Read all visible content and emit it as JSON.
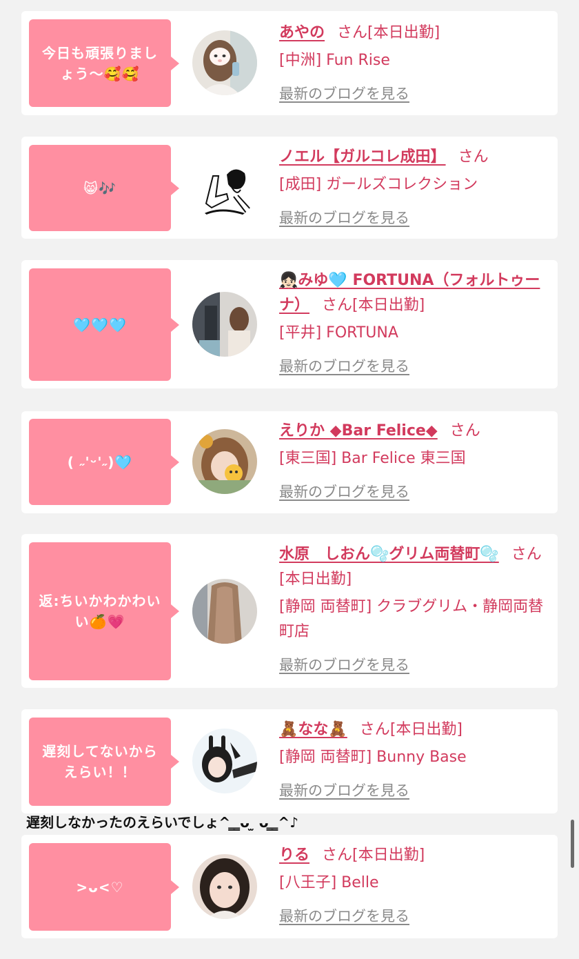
{
  "colors": {
    "bubble": "#ff8fa1",
    "name": "#d23a5d",
    "link": "#8a8a8a",
    "background": "#f2f2f2"
  },
  "posts": [
    {
      "bubble_text": "今日も頑張りましょう〜🥰🥰",
      "name": "あやの",
      "san": "さん",
      "status": "[本日出勤]",
      "shop": "[中洲] Fun Rise",
      "blog_link": "最新のブログを見る",
      "avatar_icon": "avatar-photo"
    },
    {
      "bubble_text": "😸🎶",
      "name": "ノエル【ガルコレ成田】",
      "san": "さん",
      "status": "",
      "shop": "[成田] ガールズコレクション",
      "blog_link": "最新のブログを見る",
      "avatar_icon": "avatar-illustration"
    },
    {
      "bubble_text": "🩵🩵🩵",
      "name": "👧🏻みゆ🩵 FORTUNA（フォルトゥーナ）",
      "san": "さん",
      "status": "[本日出勤]",
      "shop": "[平井] FORTUNA",
      "blog_link": "最新のブログを見る",
      "avatar_icon": "avatar-photo"
    },
    {
      "bubble_text": "( ˶'ᵕ'˶)🩵",
      "name": "えりか ◆Bar Felice◆",
      "san": "さん",
      "status": "",
      "shop": "[東三国] Bar Felice 東三国",
      "blog_link": "最新のブログを見る",
      "avatar_icon": "avatar-photo"
    },
    {
      "bubble_text": "返:ちいかわかわいい🍊💗",
      "name": "水原　しおん🫧グリム両替町🫧",
      "san": "さん",
      "status": "[本日出勤]",
      "shop": "[静岡 両替町] クラブグリム・静岡両替町店",
      "blog_link": "最新のブログを見る",
      "avatar_icon": "avatar-photo"
    },
    {
      "bubble_text": "遅刻してないからえらい！！",
      "name": "🧸なな🧸",
      "san": "さん",
      "status": "[本日出勤]",
      "shop": "[静岡 両替町] Bunny Base",
      "blog_link": "最新のブログを見る",
      "avatar_icon": "avatar-photo"
    },
    {
      "bubble_text": ">ᴗ<♡",
      "name": "りる",
      "san": "さん",
      "status": "[本日出勤]",
      "shop": "[八王子] Belle",
      "blog_link": "最新のブログを見る",
      "avatar_icon": "avatar-photo"
    }
  ],
  "reply_note": "遅刻しなかったのえらいでしょ^ ̳ ̳ᴗ ̫ ᴗ ̳ ̳^♪"
}
